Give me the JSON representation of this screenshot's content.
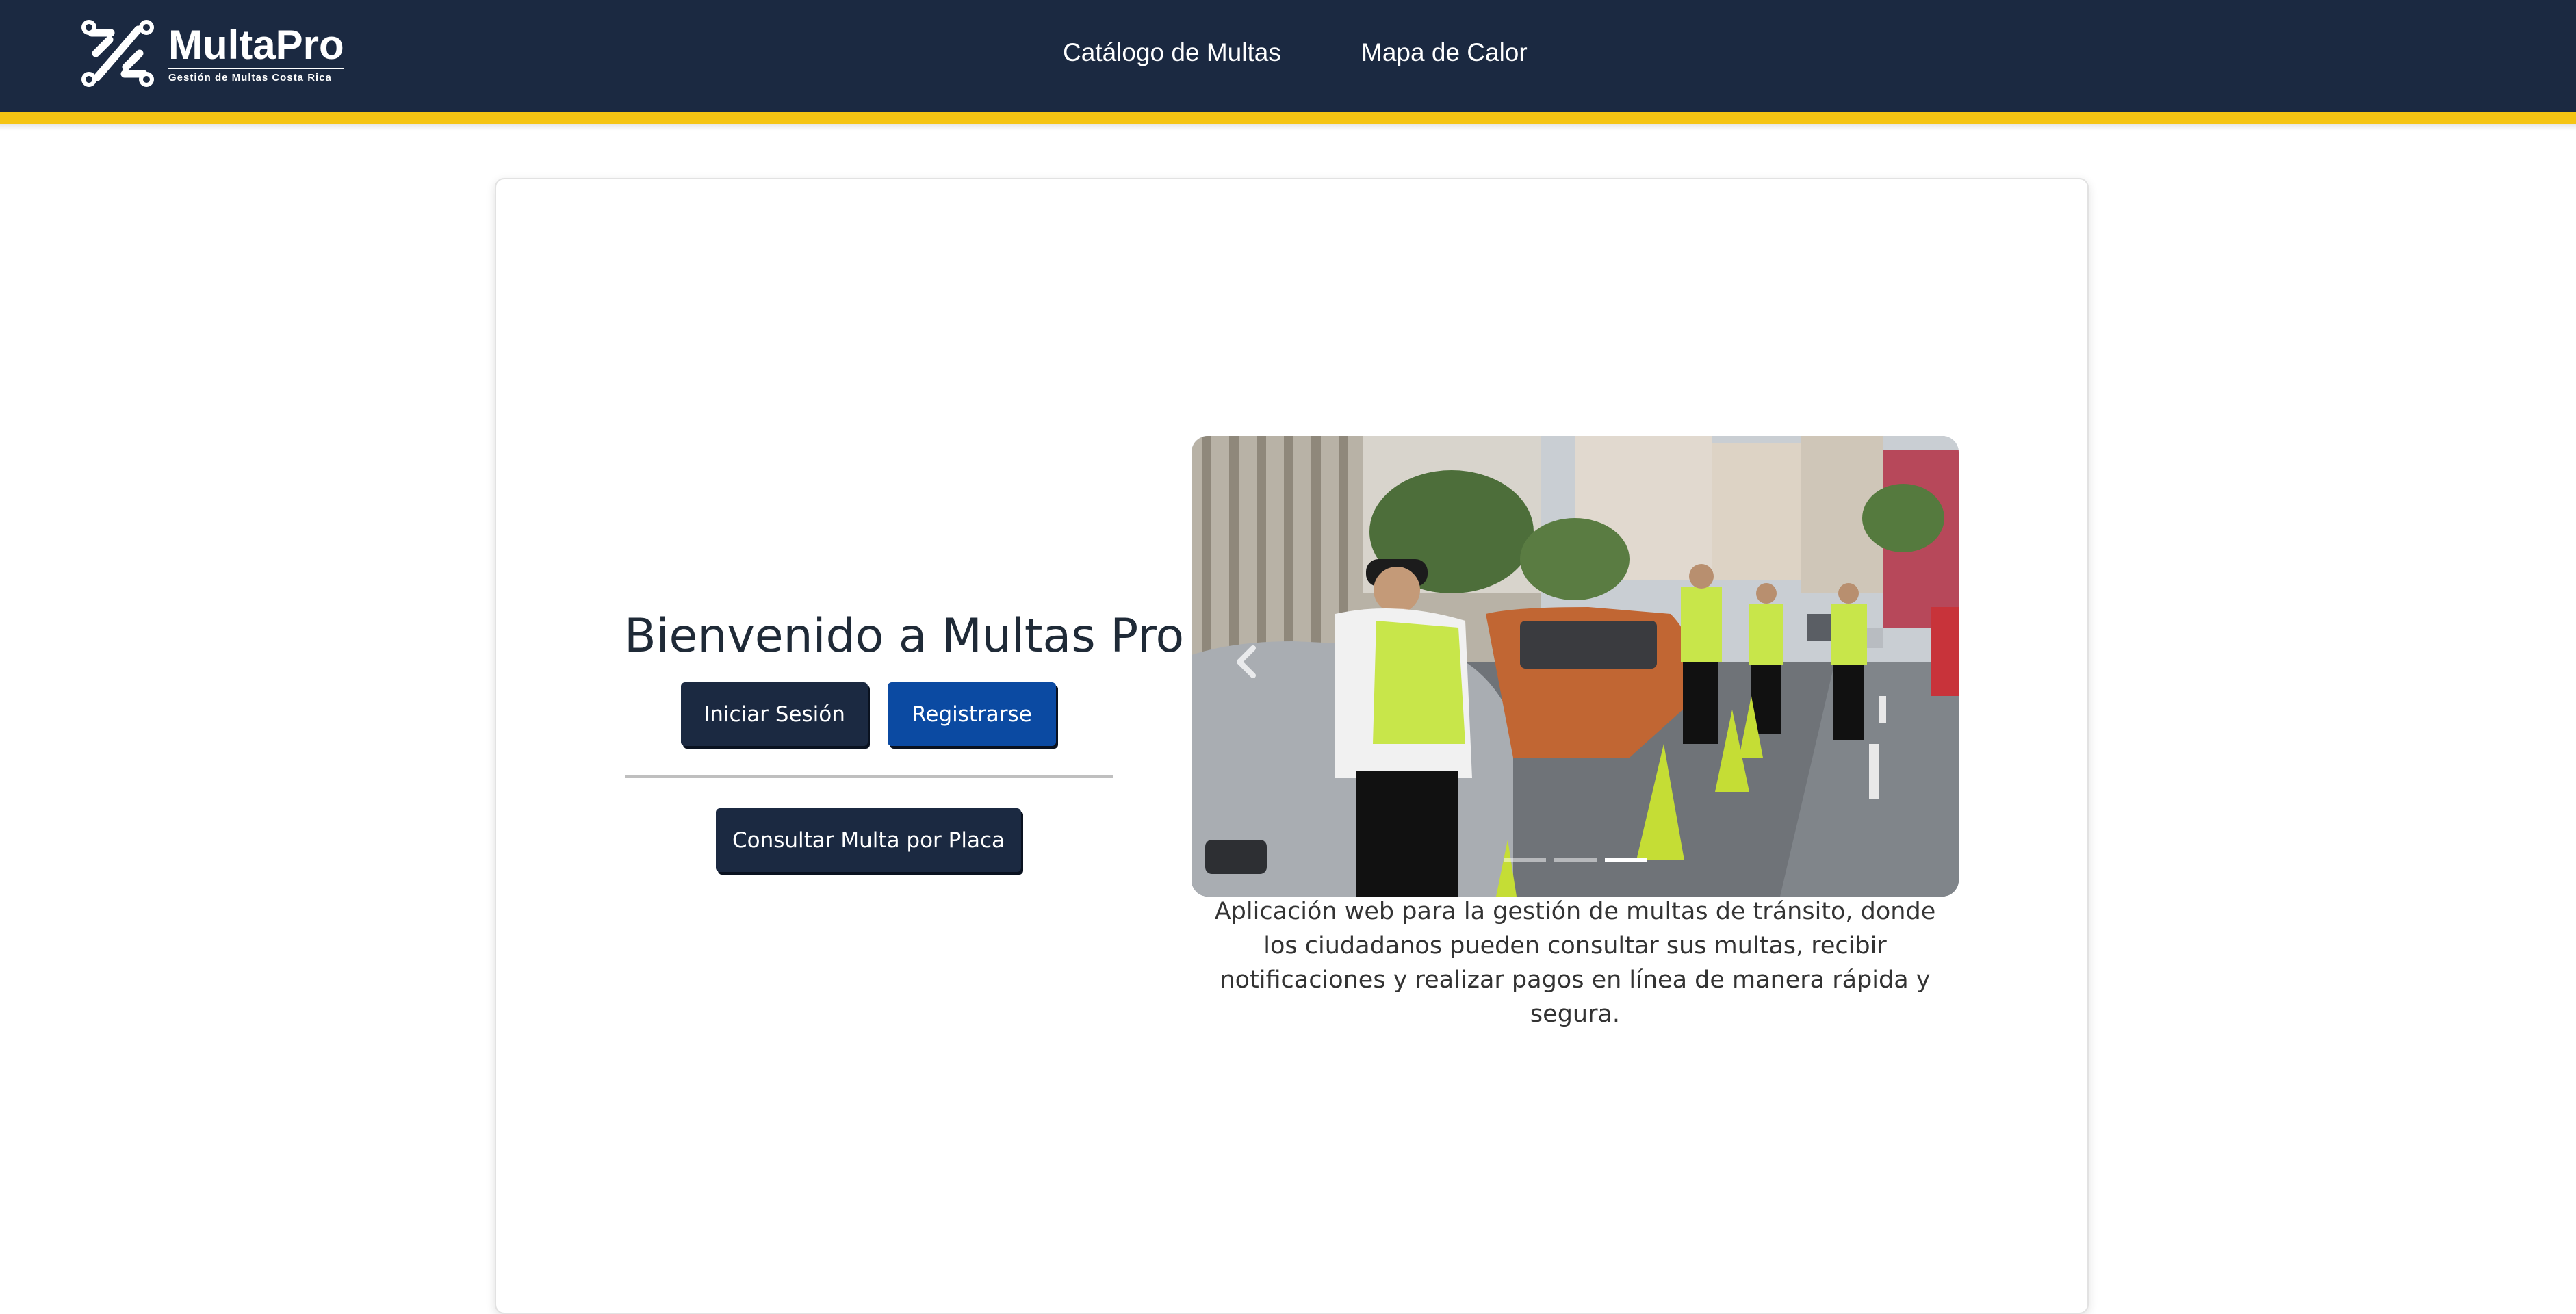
{
  "header": {
    "brand_name": "MultaPro",
    "brand_tagline": "Gestión de Multas Costa Rica",
    "nav": [
      {
        "label": "Catálogo de Multas"
      },
      {
        "label": "Mapa de Calor"
      }
    ],
    "colors": {
      "navbar": "#1b2941",
      "accent_stripe": "#f5c413"
    }
  },
  "hero": {
    "title": "Bienvenido a Multas Pro",
    "login_label": "Iniciar Sesión",
    "register_label": "Registrarse",
    "consultar_label": "Consultar Multa por Placa",
    "description": "Aplicación web para la gestión de multas de tránsito, donde los ciudadanos pueden consultar sus multas, recibir notificaciones y realizar pagos en línea de manera rápida y segura."
  },
  "carousel": {
    "image_description": "traffic-officers-street-photo",
    "slide_count": 3,
    "active_slide": 3,
    "prev_icon": "chevron-left-icon"
  }
}
